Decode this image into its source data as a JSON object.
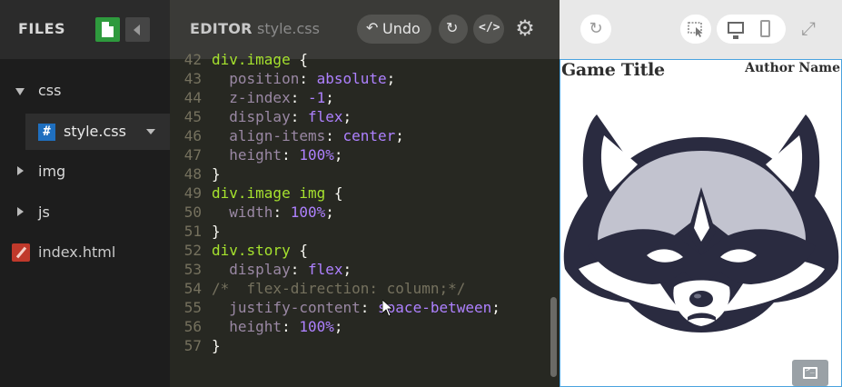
{
  "files": {
    "title": "FILES",
    "tree": {
      "css_folder": "css",
      "style_file": "style.css",
      "img_folder": "img",
      "js_folder": "js",
      "index_file": "index.html"
    }
  },
  "editor": {
    "title": "EDITOR",
    "filename": "style.css",
    "undo_label": "Undo",
    "undo_icon": "undo-icon",
    "redo_icon": "redo-icon",
    "code_icon": "code-icon",
    "settings_icon": "gear-icon",
    "lines": [
      {
        "n": "42",
        "parts": [
          [
            "sel",
            "div.image"
          ],
          [
            "plain",
            " {"
          ]
        ]
      },
      {
        "n": "43",
        "parts": [
          [
            "plain",
            "  "
          ],
          [
            "prop",
            "position"
          ],
          [
            "plain",
            ": "
          ],
          [
            "val",
            "absolute"
          ],
          [
            "plain",
            ";"
          ]
        ]
      },
      {
        "n": "44",
        "parts": [
          [
            "plain",
            "  "
          ],
          [
            "prop",
            "z-index"
          ],
          [
            "plain",
            ": "
          ],
          [
            "val",
            "-1"
          ],
          [
            "plain",
            ";"
          ]
        ]
      },
      {
        "n": "45",
        "parts": [
          [
            "plain",
            "  "
          ],
          [
            "prop",
            "display"
          ],
          [
            "plain",
            ": "
          ],
          [
            "val",
            "flex"
          ],
          [
            "plain",
            ";"
          ]
        ]
      },
      {
        "n": "46",
        "parts": [
          [
            "plain",
            "  "
          ],
          [
            "prop",
            "align-items"
          ],
          [
            "plain",
            ": "
          ],
          [
            "val",
            "center"
          ],
          [
            "plain",
            ";"
          ]
        ]
      },
      {
        "n": "47",
        "parts": [
          [
            "plain",
            "  "
          ],
          [
            "prop",
            "height"
          ],
          [
            "plain",
            ": "
          ],
          [
            "val",
            "100%"
          ],
          [
            "plain",
            ";"
          ]
        ]
      },
      {
        "n": "48",
        "parts": [
          [
            "plain",
            "}"
          ]
        ]
      },
      {
        "n": "49",
        "parts": [
          [
            "sel",
            "div.image img"
          ],
          [
            "plain",
            " {"
          ]
        ]
      },
      {
        "n": "50",
        "parts": [
          [
            "plain",
            "  "
          ],
          [
            "prop",
            "width"
          ],
          [
            "plain",
            ": "
          ],
          [
            "val",
            "100%"
          ],
          [
            "plain",
            ";"
          ]
        ]
      },
      {
        "n": "51",
        "parts": [
          [
            "plain",
            "}"
          ]
        ]
      },
      {
        "n": "52",
        "parts": [
          [
            "sel",
            "div.story"
          ],
          [
            "plain",
            " {"
          ]
        ]
      },
      {
        "n": "53",
        "parts": [
          [
            "plain",
            "  "
          ],
          [
            "prop",
            "display"
          ],
          [
            "plain",
            ": "
          ],
          [
            "val",
            "flex"
          ],
          [
            "plain",
            ";"
          ]
        ]
      },
      {
        "n": "54",
        "parts": [
          [
            "cmt",
            "/*  flex-direction: column;*/"
          ]
        ]
      },
      {
        "n": "55",
        "parts": [
          [
            "plain",
            "  "
          ],
          [
            "prop",
            "justify-content"
          ],
          [
            "plain",
            ": "
          ],
          [
            "val",
            "space-between"
          ],
          [
            "plain",
            ";"
          ]
        ]
      },
      {
        "n": "56",
        "parts": [
          [
            "plain",
            "  "
          ],
          [
            "prop",
            "height"
          ],
          [
            "plain",
            ": "
          ],
          [
            "val",
            "100%"
          ],
          [
            "plain",
            ";"
          ]
        ]
      },
      {
        "n": "57",
        "parts": [
          [
            "plain",
            "}"
          ]
        ]
      }
    ]
  },
  "preview": {
    "refresh_icon": "refresh-icon",
    "inspect_icon": "inspect-icon",
    "desktop_icon": "desktop-icon",
    "mobile_icon": "mobile-icon",
    "expand_icon": "expand-icon",
    "console_icon": "console-icon",
    "game_title": "Game Title",
    "author_name": "Author Name"
  },
  "colors": {
    "accent_green": "#2e9a3d",
    "css_file_blue": "#1f6fbf",
    "html_file_red": "#c0392b",
    "preview_border": "#4aa3df"
  }
}
